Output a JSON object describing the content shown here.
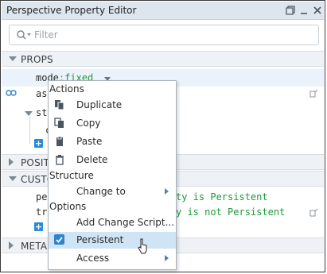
{
  "window": {
    "title": "Perspective Property Editor",
    "controls": [
      "restore-icon",
      "minimize-icon",
      "close-icon"
    ]
  },
  "filter": {
    "placeholder": "Filter"
  },
  "sections": {
    "props": "PROPS",
    "position": "POSITI",
    "custom": "CUSTO",
    "meta": "META"
  },
  "props_rows": {
    "mode_key": "mode",
    "mode_sep": ":",
    "mode_value": "fixed",
    "row2_key": "asp",
    "row3_key": "sty",
    "row4_key": "c"
  },
  "custom_rows": {
    "row1_key": "per",
    "row1_value": "ty is Persistent",
    "row2_key": "tra",
    "row2_value": "y is not Persistent"
  },
  "context_menu": {
    "actions_header": "Actions",
    "duplicate": "Duplicate",
    "copy": "Copy",
    "paste": "Paste",
    "delete": "Delete",
    "structure_header": "Structure",
    "change_to": "Change to",
    "options_header": "Options",
    "add_change_script": "Add Change Script...",
    "persistent": "Persistent",
    "access": "Access"
  },
  "colors": {
    "titlebar": "#dde5ee",
    "accent": "#2f83c9",
    "value_green": "#1f9a3a",
    "selected_item": "#cfe4f5"
  }
}
